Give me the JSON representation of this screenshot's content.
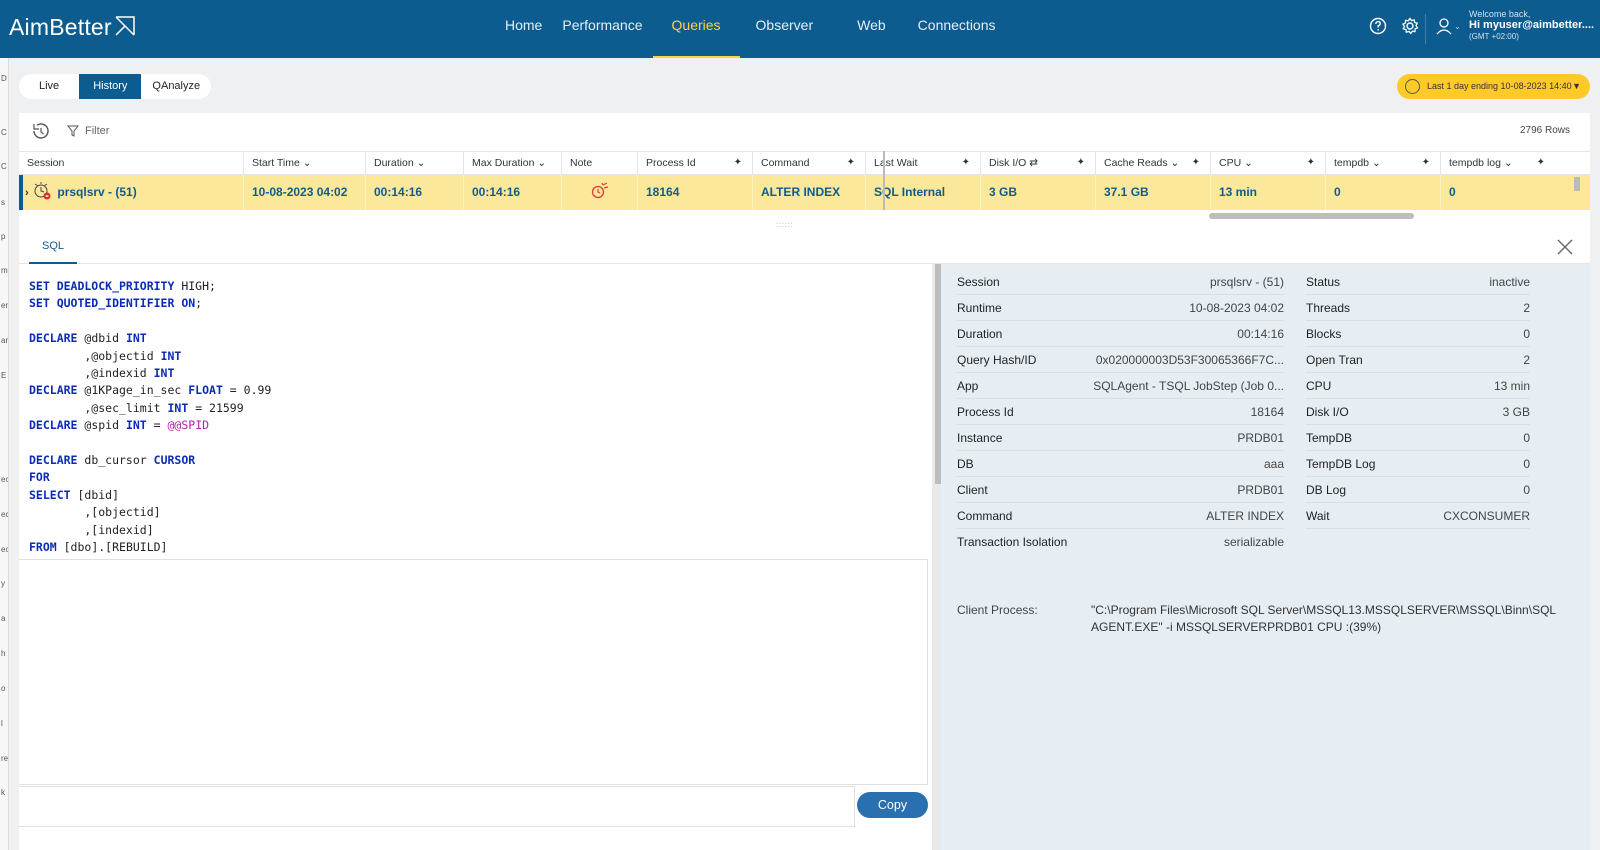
{
  "topbar": {
    "logo": "AimBetter",
    "nav": [
      "Home",
      "Performance",
      "Queries",
      "Observer",
      "Web",
      "Connections"
    ],
    "active_nav": "Queries",
    "welcome": "Welcome back,",
    "user": "Hi myuser@aimbetter....",
    "timezone": "(GMT +02:00)"
  },
  "toolbar": {
    "modes": [
      "Live",
      "History",
      "QAnalyze"
    ],
    "active_mode": "History",
    "date_range": "Last 1 day ending  10-08-2023 14:40"
  },
  "grid": {
    "filter_label": "Filter",
    "rows_count": "2796 Rows",
    "columns": [
      "Session",
      "Start Time",
      "Duration",
      "Max Duration",
      "Note",
      "Process Id",
      "Command",
      "Last Wait",
      "Disk I/O",
      "Cache Reads",
      "CPU",
      "tempdb",
      "tempdb log"
    ],
    "row": {
      "session": "prsqlsrv - (51)",
      "start_time": "10-08-2023 04:02",
      "duration": "00:14:16",
      "max_duration": "00:14:16",
      "process_id": "18164",
      "command": "ALTER INDEX",
      "last_wait": "SQL Internal",
      "disk_io": "3 GB",
      "cache_reads": "37.1 GB",
      "cpu": "13 min",
      "tempdb": "0",
      "tempdb_log": "0"
    }
  },
  "panel": {
    "tab": "SQL",
    "copy_label": "Copy",
    "details_left": [
      {
        "label": "Session",
        "value": "prsqlsrv - (51)"
      },
      {
        "label": "Runtime",
        "value": "10-08-2023 04:02"
      },
      {
        "label": "Duration",
        "value": "00:14:16"
      },
      {
        "label": "Query Hash/ID",
        "value": "0x020000003D53F30065366F7C..."
      },
      {
        "label": "App",
        "value": "SQLAgent - TSQL JobStep (Job 0..."
      },
      {
        "label": "Process Id",
        "value": "18164"
      },
      {
        "label": "Instance",
        "value": "PRDB01"
      },
      {
        "label": "DB",
        "value": "aaa"
      },
      {
        "label": "Client",
        "value": "PRDB01"
      },
      {
        "label": "Command",
        "value": "ALTER INDEX"
      },
      {
        "label": "Transaction Isolation",
        "value": "serializable"
      }
    ],
    "details_right": [
      {
        "label": "Status",
        "value": "inactive"
      },
      {
        "label": "Threads",
        "value": "2"
      },
      {
        "label": "Blocks",
        "value": "0"
      },
      {
        "label": "Open Tran",
        "value": "2"
      },
      {
        "label": "CPU",
        "value": "13 min"
      },
      {
        "label": "Disk I/O",
        "value": "3 GB"
      },
      {
        "label": "TempDB",
        "value": "0"
      },
      {
        "label": "TempDB Log",
        "value": "0"
      },
      {
        "label": "DB Log",
        "value": "0"
      },
      {
        "label": "Wait",
        "value": "CXCONSUMER"
      }
    ],
    "client_process_label": "Client Process:",
    "client_process_value": "\"C:\\Program Files\\Microsoft SQL Server\\MSSQL13.MSSQLSERVER\\MSSQL\\Binn\\SQLAGENT.EXE\" -i MSSQLSERVERPRDB01 CPU :(39%)"
  },
  "left_strip": [
    "D",
    "C",
    "s",
    "p",
    "m",
    "en",
    "ar",
    "E",
    "ec",
    "ec",
    "ec",
    "y",
    "a",
    "h",
    "o",
    "l",
    "re",
    "k"
  ]
}
